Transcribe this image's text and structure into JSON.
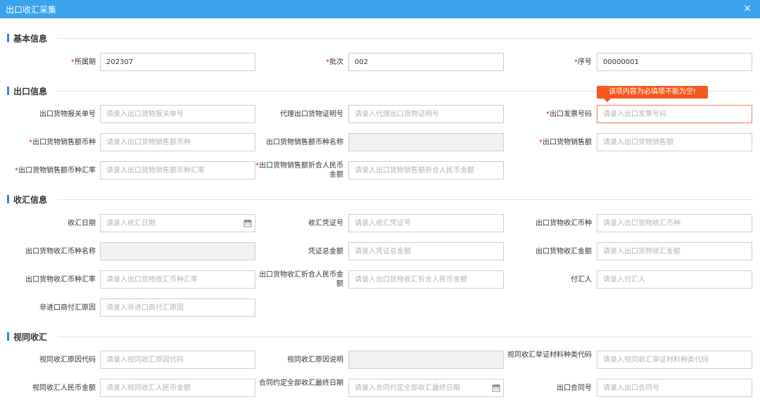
{
  "window": {
    "title": "出口收汇采集",
    "close": "×"
  },
  "sections": {
    "basic": "基本信息",
    "export": "出口信息",
    "receipt": "收汇信息",
    "deemed": "视同收汇"
  },
  "required_mark": "*",
  "basic": {
    "period_label": "所属期",
    "period_value": "202307",
    "batch_label": "批次",
    "batch_value": "002",
    "seq_label": "序号",
    "seq_value": "00000001"
  },
  "export": {
    "customs_no_label": "出口货物报关单号",
    "customs_no_ph": "请录入出口货物报关单号",
    "agent_cert_label": "代理出口货物证明号",
    "agent_cert_ph": "请录入代理出口货物证明号",
    "invoice_label": "出口发票号码",
    "invoice_ph": "请录入出口发票号码",
    "invoice_error": "该项内容为必填项不能为空!",
    "currency_label": "出口货物销售额币种",
    "currency_ph": "请录入出口货物销售额币种",
    "currency_name_label": "出口货物销售额币种名称",
    "amount_label": "出口货物销售额",
    "amount_ph": "请录入出口货物销售额",
    "rate_label": "出口货物销售额币种汇率",
    "rate_ph": "请录入出口货物销售额币种汇率",
    "rmb_label": "出口货物销售额折合人民币金额",
    "rmb_ph": "请录入出口货物销售额折合人民币金额"
  },
  "receipt": {
    "date_label": "收汇日期",
    "date_ph": "请录入收汇日期",
    "voucher_label": "收汇凭证号",
    "voucher_ph": "请录入收汇凭证号",
    "currency_label": "出口货物收汇币种",
    "currency_ph": "请录入出口货物收汇币种",
    "currency_name_label": "出口货物收汇币种名称",
    "voucher_total_label": "凭证总金额",
    "voucher_total_ph": "请录入凭证总金额",
    "amount_label": "出口货物收汇金额",
    "amount_ph": "请录入出口货物收汇金额",
    "rate_label": "出口货物收汇币种汇率",
    "rate_ph": "请录入出口货物收汇币种汇率",
    "rmb_label": "出口货物收汇折合人民币金额",
    "rmb_ph": "请录入出口货物收汇折合人民币金额",
    "payer_label": "付汇人",
    "payer_ph": "请录入付汇人",
    "reason_label": "非进口商付汇原因",
    "reason_ph": "请录入非进口商付汇原因"
  },
  "deemed": {
    "reason_code_label": "视同收汇原因代码",
    "reason_code_ph": "请录入视同收汇原因代码",
    "reason_desc_label": "视同收汇原因说明",
    "material_label": "视同收汇举证材料种类代码",
    "material_ph": "请录入视同收汇举证材料种类代码",
    "rmb_label": "视同收汇人民币金额",
    "rmb_ph": "请录入视同收汇人民币金额",
    "final_date_label": "合同约定全部收汇最终日期",
    "final_date_ph": "请录入合同约定全部收汇最终日期",
    "contract_label": "出口合同号",
    "contract_ph": "请录入出口合同号"
  },
  "colors": {
    "titlebar": "#3aa3ec",
    "accent": "#2b8be0",
    "required": "#e02020",
    "error": "#f4591f"
  },
  "icons": {
    "close": "close-icon",
    "calendar": "calendar-icon"
  }
}
